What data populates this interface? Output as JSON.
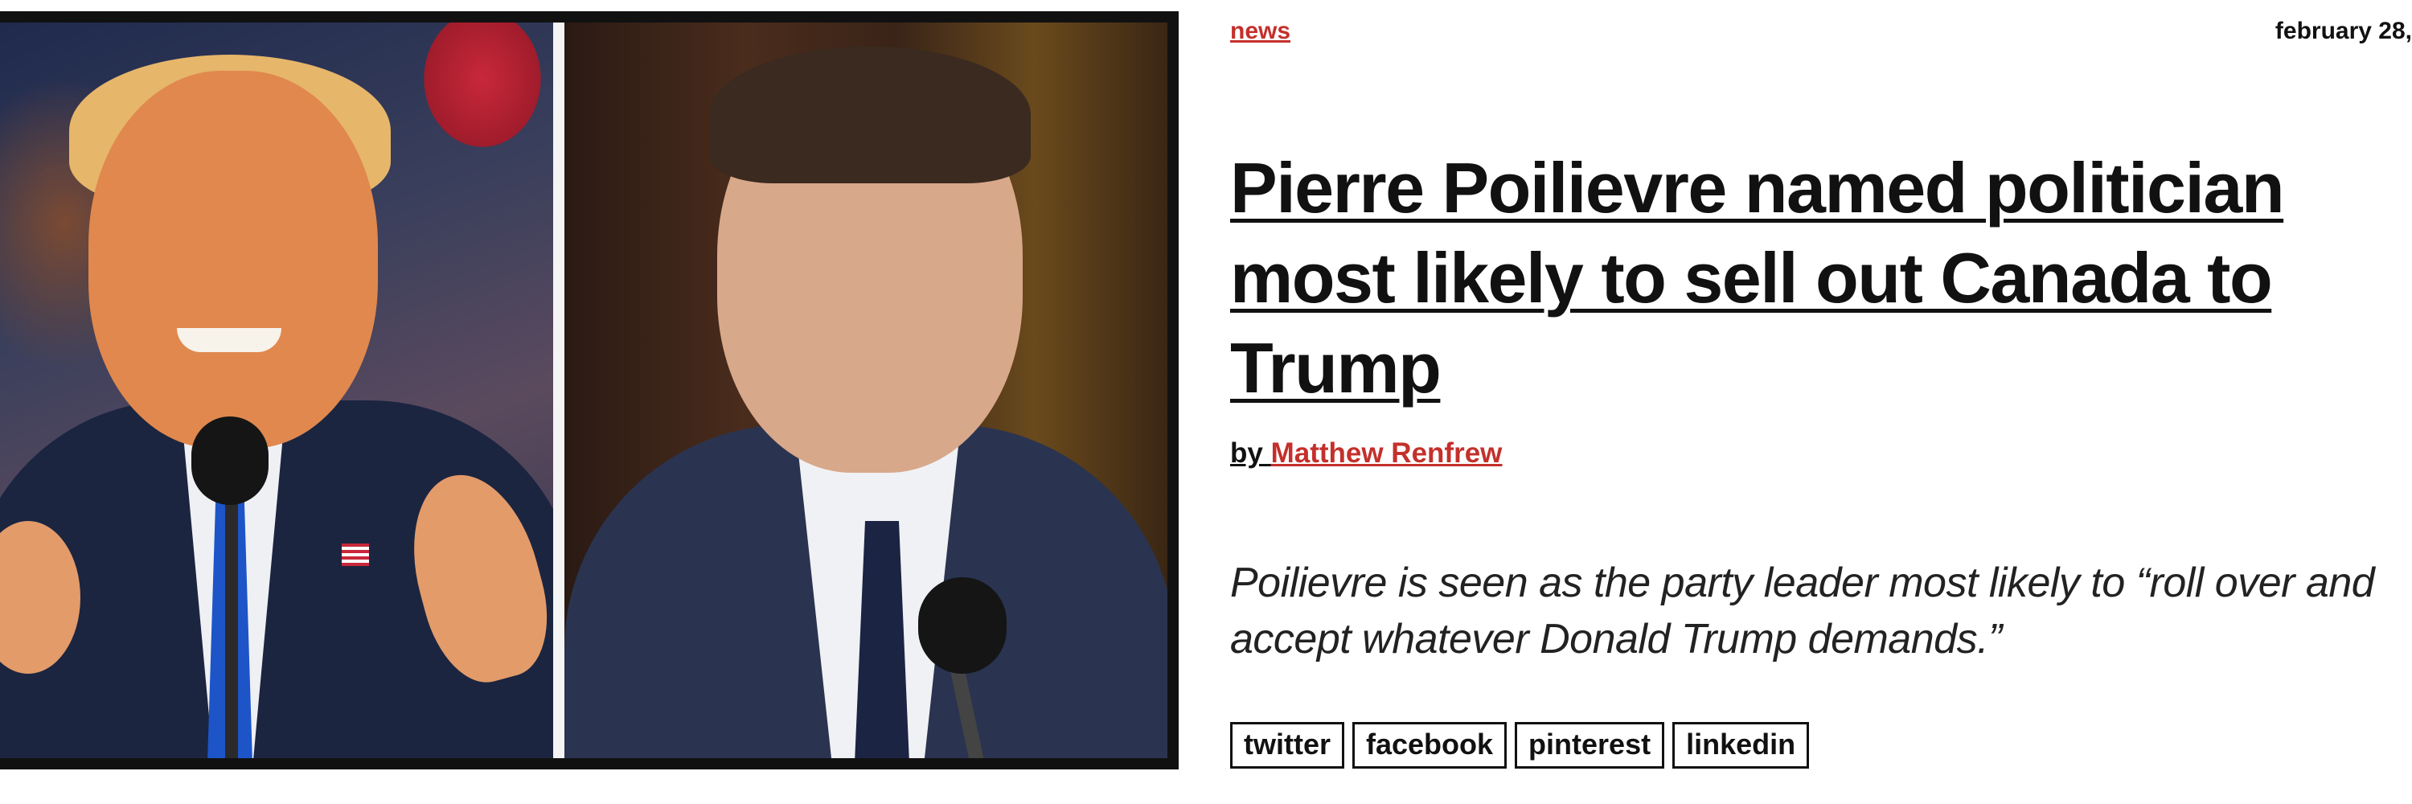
{
  "article": {
    "category": "news",
    "date": "february 28,",
    "headline": "Pierre Poilievre named politician most likely to sell out Canada to Trump",
    "byline_prefix": "by ",
    "author": "Matthew Renfrew",
    "dek": "Poilievre is seen as the party leader most likely to “roll over and accept whatever Donald Trump demands.”"
  },
  "share": {
    "buttons": [
      {
        "label": "twitter"
      },
      {
        "label": "facebook"
      },
      {
        "label": "pinterest"
      },
      {
        "label": "linkedin"
      }
    ]
  },
  "colors": {
    "accent": "#c4302b",
    "text": "#111111",
    "background": "#ffffff"
  }
}
